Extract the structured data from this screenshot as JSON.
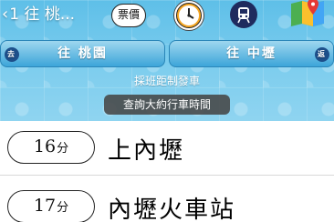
{
  "header": {
    "back_chevron": "‹",
    "back_label": "1 往 桃...",
    "fare_label": "票價",
    "clock_icon": "clock-icon",
    "train_icon": "train-icon",
    "map_icon": "map-icon"
  },
  "directions": {
    "left": {
      "tag": "去",
      "label": "往 桃園"
    },
    "right": {
      "tag": "返",
      "label": "往 中壢"
    }
  },
  "note": "採班距制發車",
  "query_button": "查詢大約行車時間",
  "stations": [
    {
      "minutes": "16",
      "unit": "分",
      "name": "上內壢"
    },
    {
      "minutes": "17",
      "unit": "分",
      "name": "內壢火車站"
    }
  ],
  "colors": {
    "header_bg": "#6fc6ea",
    "direction_button": "#3da5d9",
    "query_button": "#464646"
  }
}
